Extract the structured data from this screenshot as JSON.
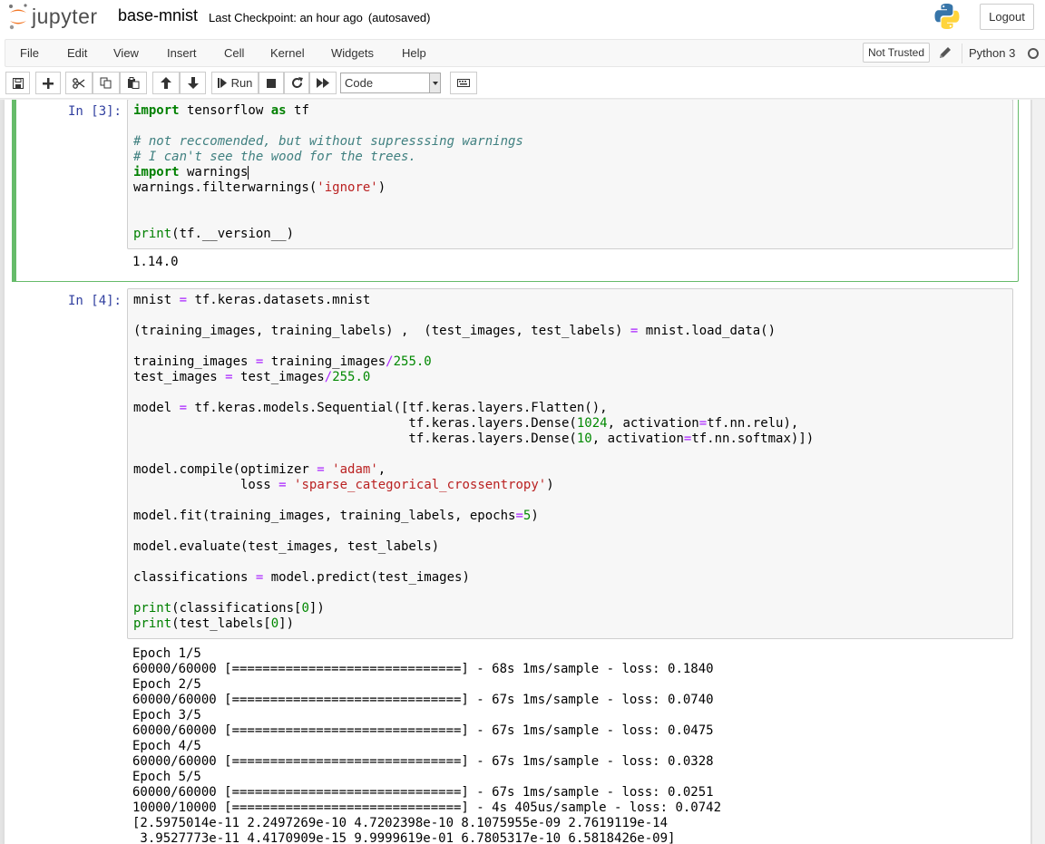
{
  "header": {
    "logo_text": "jupyter",
    "notebook_name": "base-mnist",
    "checkpoint": "Last Checkpoint: an hour ago",
    "autosave": "(autosaved)",
    "logout_label": "Logout"
  },
  "menubar": {
    "items": [
      "File",
      "Edit",
      "View",
      "Insert",
      "Cell",
      "Kernel",
      "Widgets",
      "Help"
    ],
    "not_trusted": "Not Trusted",
    "kernel_name": "Python 3"
  },
  "toolbar": {
    "run_label": "Run",
    "cell_type": "Code"
  },
  "colors": {
    "selected_border": "#66bb6a",
    "prompt": "#303f9f",
    "keyword": "#008000",
    "comment": "#408080",
    "string": "#ba2121",
    "operator": "#aa22ff"
  },
  "cells": [
    {
      "prompt": "In [3]:",
      "code_lines": [
        "import tensorflow as tf",
        "",
        "# not reccomended, but without supresssing warnings",
        "# I can't see the wood for the trees.",
        "import warnings",
        "warnings.filterwarnings('ignore')",
        "",
        "",
        "print(tf.__version__)"
      ],
      "output_lines": [
        "1.14.0"
      ]
    },
    {
      "prompt": "In [4]:",
      "code_lines": [
        "mnist = tf.keras.datasets.mnist",
        "",
        "(training_images, training_labels) ,  (test_images, test_labels) = mnist.load_data()",
        "",
        "training_images = training_images/255.0",
        "test_images = test_images/255.0",
        "",
        "model = tf.keras.models.Sequential([tf.keras.layers.Flatten(),",
        "                                    tf.keras.layers.Dense(1024, activation=tf.nn.relu),",
        "                                    tf.keras.layers.Dense(10, activation=tf.nn.softmax)])",
        "",
        "model.compile(optimizer = 'adam',",
        "              loss = 'sparse_categorical_crossentropy')",
        "",
        "model.fit(training_images, training_labels, epochs=5)",
        "",
        "model.evaluate(test_images, test_labels)",
        "",
        "classifications = model.predict(test_images)",
        "",
        "print(classifications[0])",
        "print(test_labels[0])"
      ],
      "output_lines": [
        "Epoch 1/5",
        "60000/60000 [==============================] - 68s 1ms/sample - loss: 0.1840",
        "Epoch 2/5",
        "60000/60000 [==============================] - 67s 1ms/sample - loss: 0.0740",
        "Epoch 3/5",
        "60000/60000 [==============================] - 67s 1ms/sample - loss: 0.0475",
        "Epoch 4/5",
        "60000/60000 [==============================] - 67s 1ms/sample - loss: 0.0328",
        "Epoch 5/5",
        "60000/60000 [==============================] - 67s 1ms/sample - loss: 0.0251",
        "10000/10000 [==============================] - 4s 405us/sample - loss: 0.0742",
        "[2.5975014e-11 2.2497269e-10 4.7202398e-10 8.1075955e-09 2.7619119e-14",
        " 3.9527773e-11 4.4170909e-15 9.9999619e-01 6.7805317e-10 6.5818426e-09]"
      ]
    }
  ]
}
